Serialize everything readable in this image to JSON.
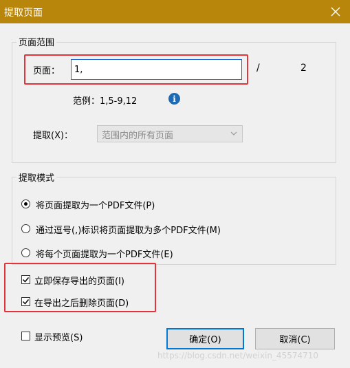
{
  "window": {
    "title": "提取页面",
    "title_bar_color": "#b8860b",
    "close_icon": "close-icon"
  },
  "page_range": {
    "legend": "页面范围",
    "pages_label": "页面：",
    "pages_value": "1,",
    "separator": "/",
    "total_pages": "2",
    "example_text": "范例：1,5-9,12",
    "info_icon": "info-icon",
    "info_glyph": "i",
    "extract_label": "提取(X)：",
    "extract_option": "范围内的所有页面"
  },
  "extract_mode": {
    "legend": "提取模式",
    "options": [
      {
        "label": "将页面提取为一个PDF文件(P)",
        "selected": true
      },
      {
        "label": "通过逗号(,)标识将页面提取为多个PDF文件(M)",
        "selected": false
      },
      {
        "label": "将每个页面提取为一个PDF文件(E)",
        "selected": false
      }
    ]
  },
  "options": {
    "save_exported": {
      "label": "立即保存导出的页面(I)",
      "checked": true
    },
    "delete_after": {
      "label": "在导出之后删除页面(D)",
      "checked": true
    },
    "show_preview": {
      "label": "显示预览(S)",
      "checked": false
    }
  },
  "buttons": {
    "ok": "确定(O)",
    "cancel": "取消(C)"
  },
  "watermark": "https://blog.csdn.net/weixin_45574710",
  "colors": {
    "highlight": "#e5333a",
    "accent": "#0078d7"
  }
}
